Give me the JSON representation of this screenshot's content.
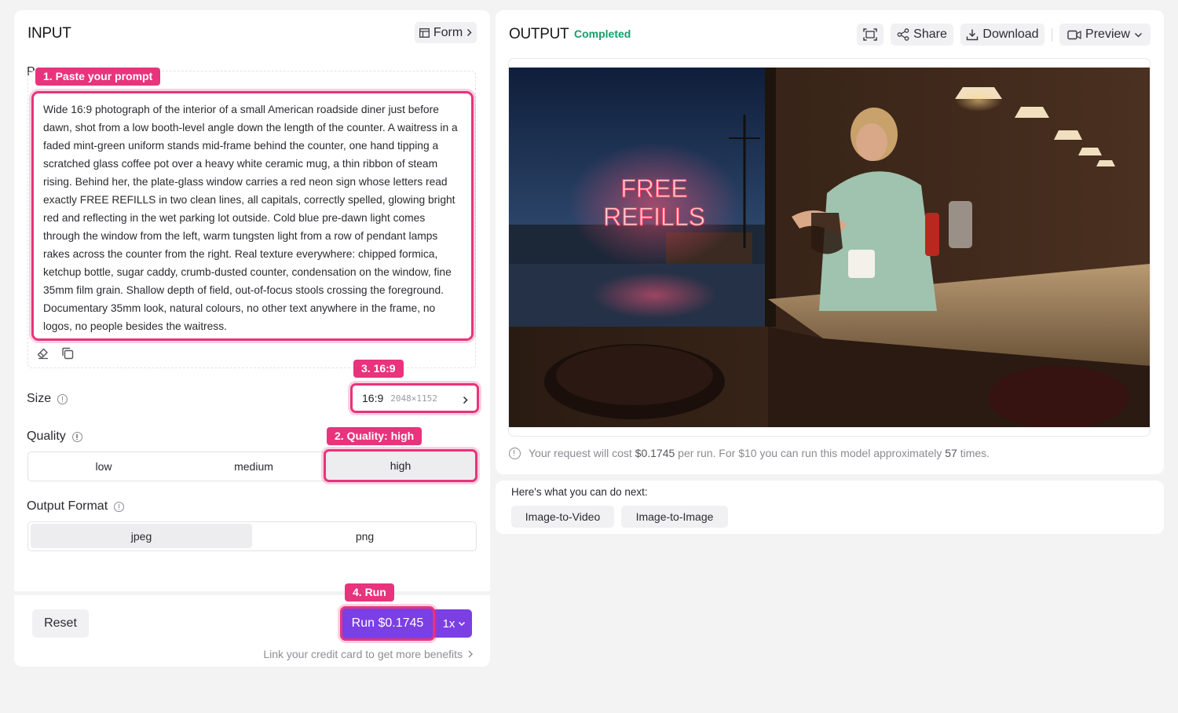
{
  "input": {
    "title": "INPUT",
    "form_label": "Form",
    "prompt_label_partial": "P",
    "prompt_text": "Wide 16:9 photograph of the interior of a small American roadside diner just before dawn, shot from a low booth-level angle down the length of the counter. A waitress in a faded mint-green uniform stands mid-frame behind the counter, one hand tipping a scratched glass coffee pot over a heavy white ceramic mug, a thin ribbon of steam rising. Behind her, the plate-glass window carries a red neon sign whose letters read exactly FREE REFILLS in two clean lines, all capitals, correctly spelled, glowing bright red and reflecting in the wet parking lot outside. Cold blue pre-dawn light comes through the window from the left, warm tungsten light from a row of pendant lamps rakes across the counter from the right. Real texture everywhere: chipped formica, ketchup bottle, sugar caddy, crumb-dusted counter, condensation on the window, fine 35mm film grain. Shallow depth of field, out-of-focus stools crossing the foreground. Documentary 35mm look, natural colours, no other text anywhere in the frame, no logos, no people besides the waitress.",
    "size_label": "Size",
    "size_ratio": "16:9",
    "size_dims": "2048×1152",
    "quality_label": "Quality",
    "quality_options": [
      "low",
      "medium",
      "high"
    ],
    "quality_selected": "high",
    "format_label": "Output Format",
    "format_options": [
      "jpeg",
      "png"
    ],
    "format_selected": "jpeg",
    "reset_label": "Reset",
    "run_label": "Run $0.1745",
    "multiplier": "1x",
    "credit_link": "Link your credit card to get more benefits"
  },
  "annotations": {
    "step1": "1. Paste your prompt",
    "step2": "2. Quality: high",
    "step3": "3. 16:9",
    "step4": "4. Run"
  },
  "output": {
    "title": "OUTPUT",
    "status": "Completed",
    "status_color": "#14a06b",
    "share_label": "Share",
    "download_label": "Download",
    "preview_label": "Preview",
    "neon_line1": "FREE",
    "neon_line2": "REFILLS",
    "cost_prefix": "Your request will cost ",
    "cost_value": "$0.1745",
    "cost_mid": " per run. For $10 you can run this model approximately ",
    "cost_count": "57",
    "cost_suffix": " times."
  },
  "next": {
    "title": "Here's what you can do next:",
    "chips": [
      "Image-to-Video",
      "Image-to-Image"
    ]
  },
  "colors": {
    "accent_pink": "#e8347c",
    "run_purple": "#7b3fe4"
  }
}
